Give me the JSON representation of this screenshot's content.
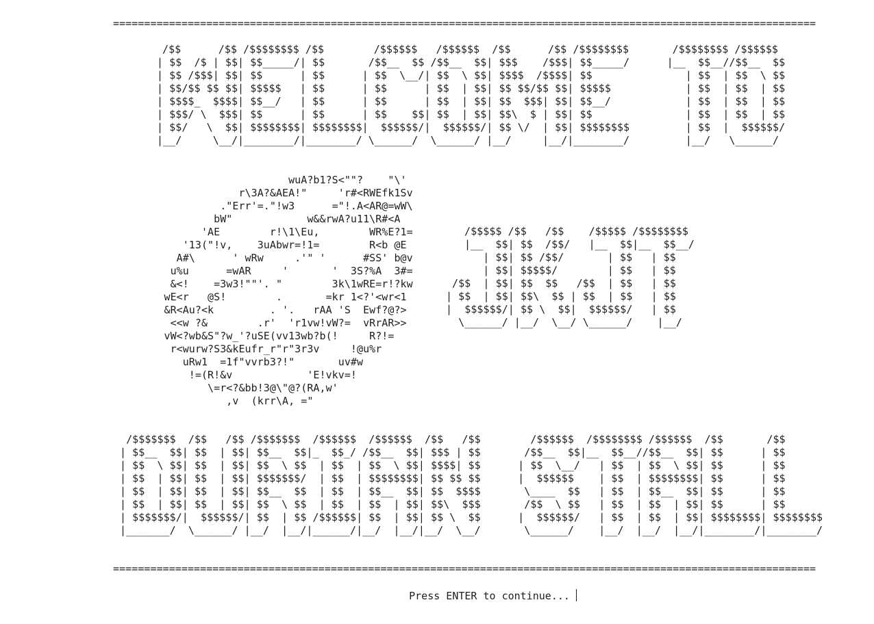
{
  "terminal": {
    "separator_top": "=================================================================================================================",
    "title_banner": [
      "/$$      /$$ /$$$$$$$$ /$$        /$$$$$$   /$$$$$$  /$$      /$$ /$$$$$$$$       /$$$$$$$$ /$$$$$$",
      "| $$  /$ | $$| $$_____/| $$       /$$__  $$ /$$__  $$| $$$    /$$$| $$_____/      |__  $$__//$$__  $$",
      "| $$ /$$$| $$| $$      | $$      | $$  \\__/| $$  \\ $$| $$$$  /$$$$| $$               | $$  | $$  \\ $$",
      "| $$/$$ $$ $$| $$$$$   | $$      | $$      | $$  | $$| $$ $$/$$ $$| $$$$$            | $$  | $$  | $$",
      "| $$$$_  $$$$| $$__/   | $$      | $$      | $$  | $$| $$  $$$| $$| $$__/            | $$  | $$  | $$",
      "| $$$/ \\  $$$| $$      | $$      | $$    $$| $$  | $$| $$\\  $ | $$| $$               | $$  | $$  | $$",
      "| $$/   \\  $$| $$$$$$$$| $$$$$$$$|  $$$$$$/|  $$$$$$/| $$ \\/  | $$| $$$$$$$$         | $$  |  $$$$$$/",
      "|__/     \\__/|________/|________/ \\______/  \\______/ |__/     |__/|________/         |__/   \\______/"
    ],
    "logo_art": [
      "                          wuA?b1?S<\"\"?    \"\\'",
      "                  r\\3A?&AEA!\"     'r#<RWEfk1Sv",
      "               .\"Err'=.\"!w3      =\"!.A<AR@=wW\\",
      "              bW\"            w&&rwA?u11\\R#<A",
      "            'AE        r!\\1\\Eu,        WR%E?1=",
      "         '13(\"!v,    3uAbwr=!1=        R<b @E",
      "        A#\\      ' wRw     .'\" '      #SS' b@v",
      "       u%u      =wAR     '       '  3S?%A  3#=",
      "       &<!    =3w3!\"\"'. \"        3k\\1wRE=r!?kw",
      "      wE<r   @S!        .       =kr 1<?'<wr<1",
      "      &R<Au?<k         . '.   rAA 'S  Ewf?@?>",
      "       <<w ?&        .r'  'r1vw!vW?=  vRrAR>>",
      "      vW<?wb&S\"?w_'?uSE(vv13wb?b(!     R?!=",
      "       r<wurw?S3&kEufr_r\"r\"3r3v     !@u%r",
      "         uRw1  =1f\"vvrb3?!\"       uv#w",
      "          !=(R!&v            'E!vkv=!",
      "             \\=r<?&bb!3@\\\"@?(RA,w'",
      "                ,v  (krr\\A, =\""
    ],
    "jsu_banner": [
      "/$$$$$ /$$   /$$    /$$$$$ /$$$$$$$$",
      "|__  $$| $$  /$$/   |__  $$|__  $$__/",
      "   | $$| $$ /$$/       | $$   | $$",
      "   | $$| $$$$$/        | $$   | $$",
      "/$$  | $$| $$  $$   /$$  | $$   | $$",
      "| $$  | $$| $$\\  $$ | $$  | $$   | $$",
      "|  $$$$$$/| $$ \\  $$|  $$$$$$/   | $$",
      " \\______/ |__/  \\__/ \\______/    |__/"
    ],
    "subtitle_banner": [
      " /$$$$$$$  /$$   /$$ /$$$$$$$  /$$$$$$  /$$$$$$  /$$   /$$        /$$$$$$  /$$$$$$$$ /$$$$$$  /$$       /$$",
      "| $$__  $$| $$  | $$| $$__  $$|_  $$_/ /$$__  $$| $$$ | $$       /$$__  $$|__  $$__//$$__  $$| $$      | $$",
      "| $$  \\ $$| $$  | $$| $$  \\ $$  | $$  | $$  \\ $$| $$$$| $$      | $$  \\__/   | $$  | $$  \\ $$| $$      | $$",
      "| $$  | $$| $$  | $$| $$$$$$$/  | $$  | $$$$$$$$| $$ $$ $$      |  $$$$$$    | $$  | $$$$$$$$| $$      | $$",
      "| $$  | $$| $$  | $$| $$__  $$  | $$  | $$__  $$| $$  $$$$       \\____  $$   | $$  | $$__  $$| $$      | $$",
      "| $$  | $$| $$  | $$| $$  \\ $$  | $$  | $$  | $$| $$\\  $$$       /$$  \\ $$   | $$  | $$  | $$| $$      | $$",
      "| $$$$$$$/|  $$$$$$/| $$  | $$ /$$$$$$| $$  | $$| $$ \\  $$      |  $$$$$$/   | $$  | $$  | $$| $$$$$$$$| $$$$$$$$",
      "|_______/  \\______/ |__/  |__/|______/|__/  |__/|__/  \\__/       \\______/    |__/  |__/  |__/|________/|________/"
    ],
    "separator_bottom": "=================================================================================================================",
    "prompt": "Press ENTER to continue..."
  }
}
